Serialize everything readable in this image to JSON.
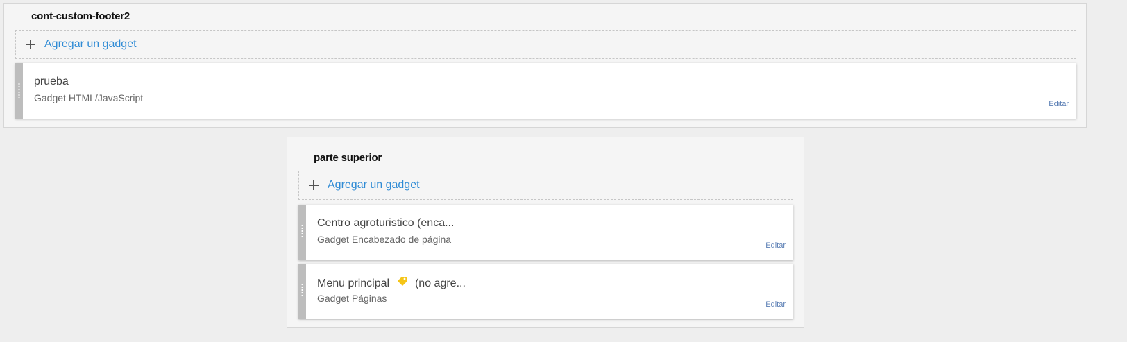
{
  "footer_section": {
    "title": "cont-custom-footer2",
    "add_label": "Agregar un gadget",
    "gadgets": [
      {
        "title": "prueba",
        "type": "Gadget HTML/JavaScript",
        "edit_label": "Editar"
      }
    ]
  },
  "top_section": {
    "title": "parte superior",
    "add_label": "Agregar un gadget",
    "gadgets": [
      {
        "title": "Centro agroturistico (enca...",
        "type": "Gadget Encabezado de página",
        "edit_label": "Editar"
      },
      {
        "title_before_icon": "Menu principal",
        "title_after_icon": "(no agre...",
        "icon": "tag-icon",
        "type": "Gadget Páginas",
        "edit_label": "Editar"
      }
    ]
  },
  "colors": {
    "link_blue": "#2f8bd5",
    "edit_blue": "#5b7fb5",
    "tag_yellow": "#f5c518",
    "handle_gray": "#bdbdbd"
  }
}
